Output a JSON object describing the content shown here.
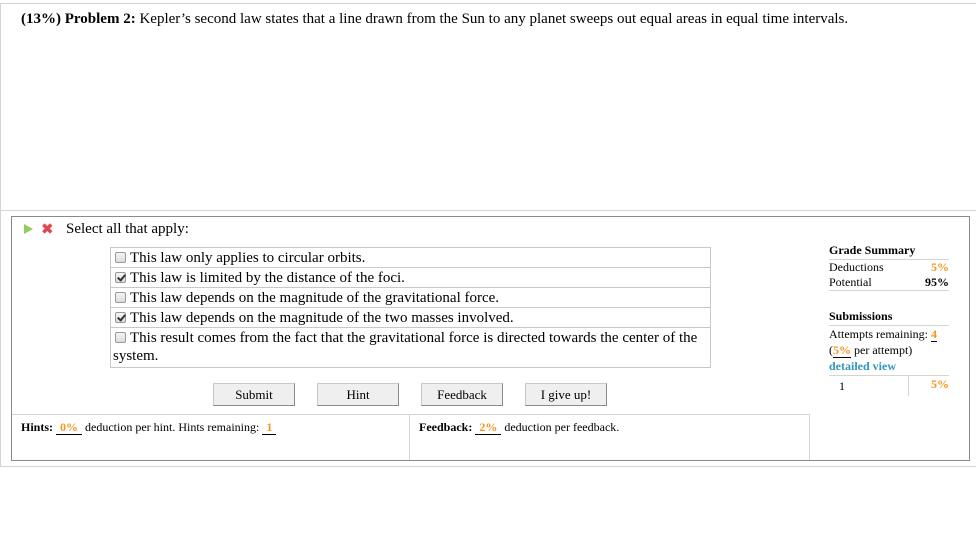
{
  "problem": {
    "weight": "(13%)",
    "label": "Problem 2:",
    "text": "Kepler’s second law states that a line drawn from the Sun to any planet sweeps out equal areas in equal time intervals."
  },
  "question": {
    "icons": [
      "play-icon",
      "incorrect-x-icon"
    ],
    "instruction": "Select all that apply:",
    "options": [
      {
        "label": "This law only applies to circular orbits.",
        "checked": false
      },
      {
        "label": "This law is limited by the distance of the foci.",
        "checked": true
      },
      {
        "label": "This law depends on the magnitude of the gravitational force.",
        "checked": false
      },
      {
        "label": "This law depends on the magnitude of the two masses involved.",
        "checked": true
      },
      {
        "label": "This result comes from the fact that the gravitational force is directed towards the center of the system.",
        "checked": false
      }
    ]
  },
  "buttons": {
    "submit": "Submit",
    "hint": "Hint",
    "feedback": "Feedback",
    "give_up": "I give up!"
  },
  "hints": {
    "label": "Hints:",
    "deduction": "0%",
    "middle_text": "deduction per hint. Hints remaining:",
    "remaining": "1"
  },
  "feedback": {
    "label": "Feedback:",
    "deduction": "2%",
    "suffix": "deduction per feedback."
  },
  "grade_summary": {
    "heading": "Grade Summary",
    "deductions_label": "Deductions",
    "deductions_value": "5%",
    "potential_label": "Potential",
    "potential_value": "95%"
  },
  "submissions": {
    "heading": "Submissions",
    "attempts_label": "Attempts remaining:",
    "attempts_value": "4",
    "per_attempt_open": "(",
    "per_attempt_value": "5%",
    "per_attempt_close": " per attempt)",
    "detailed_view": "detailed view",
    "history": [
      {
        "attempt": "1",
        "deduction": "5%"
      }
    ]
  },
  "colors": {
    "accent_orange": "#f7941d",
    "link_blue": "#2f97b8",
    "incorrect_red": "#e0444c",
    "play_green": "#8fcf5a"
  }
}
